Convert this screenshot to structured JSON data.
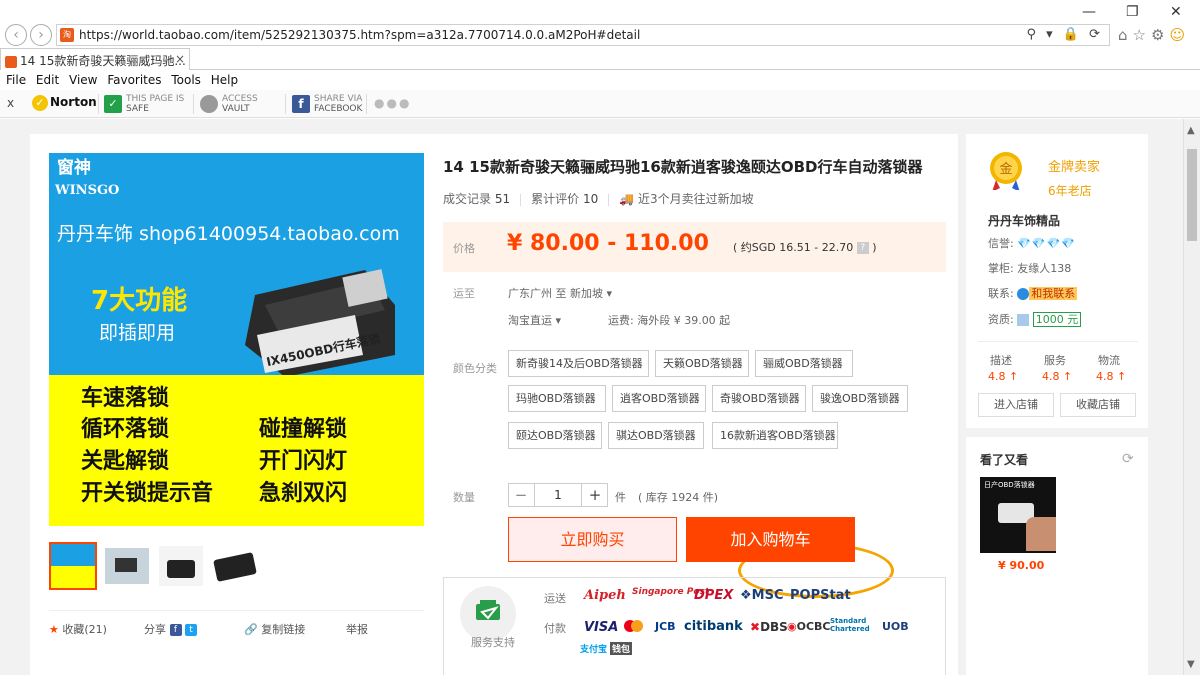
{
  "browser": {
    "url": "https://world.taobao.com/item/525292130375.htm?spm=a312a.7700714.0.0.aM2PoH#detail",
    "tab_title": "14 15款新奇骏天籁骊威玛驰...",
    "tab_close": "×",
    "menu": [
      "File",
      "Edit",
      "View",
      "Favorites",
      "Tools",
      "Help"
    ],
    "window_controls": [
      "—",
      "❐",
      "✕"
    ],
    "address_icons": "⚲ ▾ 🔒 ⟳",
    "toolbar_icons": [
      "⌂",
      "☆",
      "⚙",
      "☺"
    ],
    "norton": {
      "close": "x",
      "logo": "Norton",
      "items": [
        {
          "line1": "THIS PAGE IS",
          "line2": "SAFE"
        },
        {
          "line1": "ACCESS",
          "line2": "VAULT"
        },
        {
          "line1": "SHARE VIA",
          "line2": "FACEBOOK"
        }
      ],
      "more": "●●●"
    }
  },
  "product_image": {
    "brand_cn": "窗神",
    "brand_en": "WINSGO",
    "shop": "丹丹车饰 shop61400954.taobao.com",
    "headline": "7大功能",
    "subline": "即插即用",
    "device_label": "IX450OBD行车落锁",
    "features": [
      "车速落锁",
      "循环落锁",
      "关匙解锁",
      "开关锁提示音",
      "碰撞解锁",
      "开门闪灯",
      "急刹双闪"
    ]
  },
  "actions": {
    "favorite": "收藏(21)",
    "share": "分享",
    "copy_link": "复制链接",
    "report": "举报"
  },
  "product": {
    "title": "14 15款新奇骏天籁骊威玛驰16款新逍客骏逸颐达OBD行车自动落锁器",
    "sales_label": "成交记录",
    "sales_count": "51",
    "reviews_label": "累计评价",
    "reviews_count": "10",
    "shipped_note": "近3个月卖往过新加坡",
    "price_label": "价格",
    "price": "¥ 80.00 - 110.00",
    "price_sgd": "( 约SGD 16.51 - 22.70",
    "price_sgd_close": ")",
    "shipping_label": "运至",
    "shipping_route": "广东广州 至  新加坡 ▾",
    "shipping_method": "淘宝直运 ▾",
    "shipping_fee": "运费: 海外段 ¥ 39.00 起",
    "color_label": "颜色分类",
    "options": [
      "新奇骏14及后OBD落锁器",
      "天籁OBD落锁器",
      "骊威OBD落锁器",
      "玛驰OBD落锁器",
      "逍客OBD落锁器",
      "奇骏OBD落锁器",
      "骏逸OBD落锁器",
      "颐达OBD落锁器",
      "骐达OBD落锁器",
      "16款新逍客OBD落锁器"
    ],
    "qty_label": "数量",
    "qty_value": "1",
    "qty_unit": "件",
    "stock": "( 库存 1924 件)",
    "buy_now": "立即购买",
    "add_to_cart": "加入购物车"
  },
  "service": {
    "label": "服务支持",
    "shipping_label": "运送",
    "payment_label": "付款",
    "shipping_logos": [
      "Aipeh",
      "Singapore Post",
      "DPEX",
      "❖MSC",
      "POPStat"
    ],
    "payment_logos": [
      "VISA",
      "JCB",
      "citibank",
      "DBS",
      "OCBC",
      "Standard Chartered",
      "UOB",
      "支付宝",
      "钱包"
    ]
  },
  "seller": {
    "badge_char": "金",
    "tier": "金牌卖家",
    "years": "6年老店",
    "shop_name": "丹丹车饰精品",
    "rep_label": "信誉:",
    "rep_diamonds": "💎💎💎💎",
    "owner_label": "掌柜:",
    "owner": "友缘人138",
    "contact_label": "联系:",
    "contact": "和我联系",
    "deposit_label": "资质:",
    "deposit": "1000 元",
    "ratings": [
      {
        "label": "描述",
        "value": "4.8 ↑"
      },
      {
        "label": "服务",
        "value": "4.8 ↑"
      },
      {
        "label": "物流",
        "value": "4.8 ↑"
      }
    ],
    "enter_shop": "进入店铺",
    "fav_shop": "收藏店铺"
  },
  "also_viewed": {
    "title": "看了又看",
    "refresh": "⟳",
    "item_price": "¥ 90.00",
    "item_caption": "日产OBD落锁器"
  },
  "colors": {
    "accent": "#ff4400",
    "highlight_circle": "#f5a400"
  }
}
